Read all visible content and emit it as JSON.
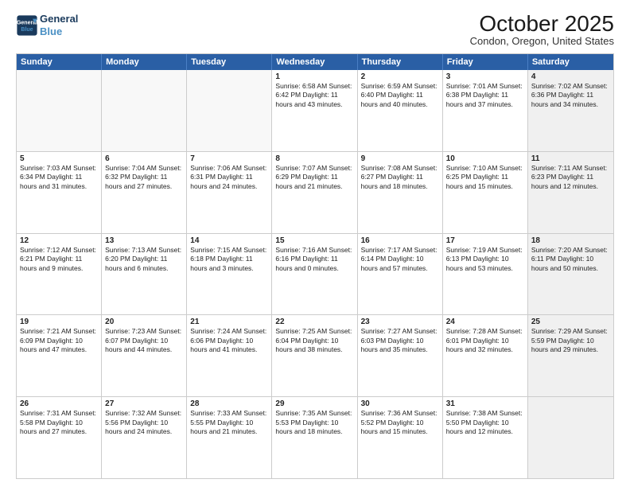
{
  "logo": {
    "line1": "General",
    "line2": "Blue"
  },
  "title": "October 2025",
  "subtitle": "Condon, Oregon, United States",
  "days": [
    "Sunday",
    "Monday",
    "Tuesday",
    "Wednesday",
    "Thursday",
    "Friday",
    "Saturday"
  ],
  "weeks": [
    [
      {
        "num": "",
        "info": "",
        "empty": true
      },
      {
        "num": "",
        "info": "",
        "empty": true
      },
      {
        "num": "",
        "info": "",
        "empty": true
      },
      {
        "num": "1",
        "info": "Sunrise: 6:58 AM\nSunset: 6:42 PM\nDaylight: 11 hours\nand 43 minutes."
      },
      {
        "num": "2",
        "info": "Sunrise: 6:59 AM\nSunset: 6:40 PM\nDaylight: 11 hours\nand 40 minutes."
      },
      {
        "num": "3",
        "info": "Sunrise: 7:01 AM\nSunset: 6:38 PM\nDaylight: 11 hours\nand 37 minutes."
      },
      {
        "num": "4",
        "info": "Sunrise: 7:02 AM\nSunset: 6:36 PM\nDaylight: 11 hours\nand 34 minutes.",
        "shaded": true
      }
    ],
    [
      {
        "num": "5",
        "info": "Sunrise: 7:03 AM\nSunset: 6:34 PM\nDaylight: 11 hours\nand 31 minutes."
      },
      {
        "num": "6",
        "info": "Sunrise: 7:04 AM\nSunset: 6:32 PM\nDaylight: 11 hours\nand 27 minutes."
      },
      {
        "num": "7",
        "info": "Sunrise: 7:06 AM\nSunset: 6:31 PM\nDaylight: 11 hours\nand 24 minutes."
      },
      {
        "num": "8",
        "info": "Sunrise: 7:07 AM\nSunset: 6:29 PM\nDaylight: 11 hours\nand 21 minutes."
      },
      {
        "num": "9",
        "info": "Sunrise: 7:08 AM\nSunset: 6:27 PM\nDaylight: 11 hours\nand 18 minutes."
      },
      {
        "num": "10",
        "info": "Sunrise: 7:10 AM\nSunset: 6:25 PM\nDaylight: 11 hours\nand 15 minutes."
      },
      {
        "num": "11",
        "info": "Sunrise: 7:11 AM\nSunset: 6:23 PM\nDaylight: 11 hours\nand 12 minutes.",
        "shaded": true
      }
    ],
    [
      {
        "num": "12",
        "info": "Sunrise: 7:12 AM\nSunset: 6:21 PM\nDaylight: 11 hours\nand 9 minutes."
      },
      {
        "num": "13",
        "info": "Sunrise: 7:13 AM\nSunset: 6:20 PM\nDaylight: 11 hours\nand 6 minutes."
      },
      {
        "num": "14",
        "info": "Sunrise: 7:15 AM\nSunset: 6:18 PM\nDaylight: 11 hours\nand 3 minutes."
      },
      {
        "num": "15",
        "info": "Sunrise: 7:16 AM\nSunset: 6:16 PM\nDaylight: 11 hours\nand 0 minutes."
      },
      {
        "num": "16",
        "info": "Sunrise: 7:17 AM\nSunset: 6:14 PM\nDaylight: 10 hours\nand 57 minutes."
      },
      {
        "num": "17",
        "info": "Sunrise: 7:19 AM\nSunset: 6:13 PM\nDaylight: 10 hours\nand 53 minutes."
      },
      {
        "num": "18",
        "info": "Sunrise: 7:20 AM\nSunset: 6:11 PM\nDaylight: 10 hours\nand 50 minutes.",
        "shaded": true
      }
    ],
    [
      {
        "num": "19",
        "info": "Sunrise: 7:21 AM\nSunset: 6:09 PM\nDaylight: 10 hours\nand 47 minutes."
      },
      {
        "num": "20",
        "info": "Sunrise: 7:23 AM\nSunset: 6:07 PM\nDaylight: 10 hours\nand 44 minutes."
      },
      {
        "num": "21",
        "info": "Sunrise: 7:24 AM\nSunset: 6:06 PM\nDaylight: 10 hours\nand 41 minutes."
      },
      {
        "num": "22",
        "info": "Sunrise: 7:25 AM\nSunset: 6:04 PM\nDaylight: 10 hours\nand 38 minutes."
      },
      {
        "num": "23",
        "info": "Sunrise: 7:27 AM\nSunset: 6:03 PM\nDaylight: 10 hours\nand 35 minutes."
      },
      {
        "num": "24",
        "info": "Sunrise: 7:28 AM\nSunset: 6:01 PM\nDaylight: 10 hours\nand 32 minutes."
      },
      {
        "num": "25",
        "info": "Sunrise: 7:29 AM\nSunset: 5:59 PM\nDaylight: 10 hours\nand 29 minutes.",
        "shaded": true
      }
    ],
    [
      {
        "num": "26",
        "info": "Sunrise: 7:31 AM\nSunset: 5:58 PM\nDaylight: 10 hours\nand 27 minutes."
      },
      {
        "num": "27",
        "info": "Sunrise: 7:32 AM\nSunset: 5:56 PM\nDaylight: 10 hours\nand 24 minutes."
      },
      {
        "num": "28",
        "info": "Sunrise: 7:33 AM\nSunset: 5:55 PM\nDaylight: 10 hours\nand 21 minutes."
      },
      {
        "num": "29",
        "info": "Sunrise: 7:35 AM\nSunset: 5:53 PM\nDaylight: 10 hours\nand 18 minutes."
      },
      {
        "num": "30",
        "info": "Sunrise: 7:36 AM\nSunset: 5:52 PM\nDaylight: 10 hours\nand 15 minutes."
      },
      {
        "num": "31",
        "info": "Sunrise: 7:38 AM\nSunset: 5:50 PM\nDaylight: 10 hours\nand 12 minutes."
      },
      {
        "num": "",
        "info": "",
        "empty": true,
        "shaded": true
      }
    ]
  ]
}
